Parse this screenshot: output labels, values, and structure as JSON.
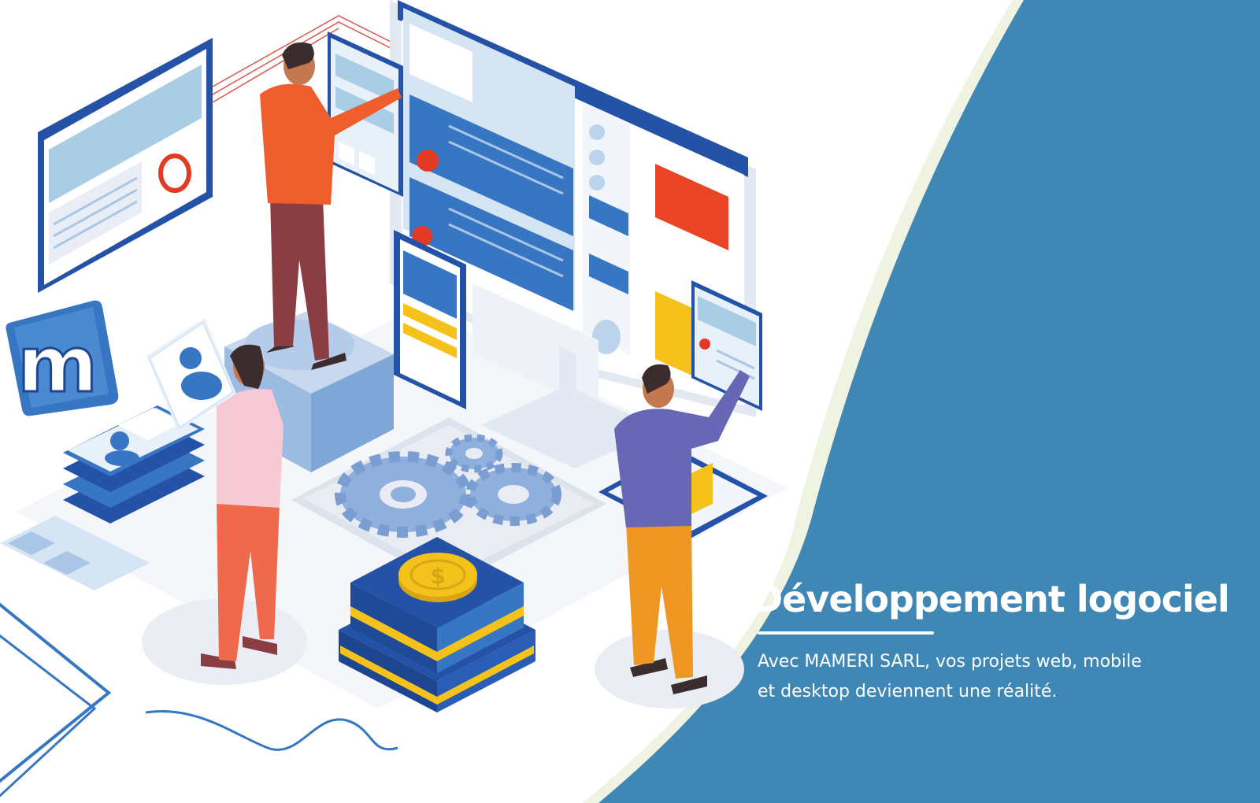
{
  "headline": {
    "title": "Développement logociel",
    "subtitle_line1": "Avec MAMERI SARL, vos projets web, mobile",
    "subtitle_line2": "et desktop deviennent une réalité."
  },
  "logo": {
    "letter": "m"
  },
  "colors": {
    "panel_blue": "#3f87b4",
    "accent_cream": "#eef3e2",
    "navy": "#2452a6",
    "mid_blue": "#3676c2",
    "light_blue": "#a9c6e6",
    "pale_blue": "#d6e5f4",
    "red": "#e23a23",
    "orange_shirt": "#ee5d2c",
    "maroon_pants": "#8a3e44",
    "pink_shirt": "#f7c9d4",
    "coral_pants": "#ef6a4c",
    "purple_shirt": "#6867b5",
    "mustard_pants": "#ee9722",
    "gold": "#f4c21a",
    "skin": "#c4784f",
    "hair": "#3b2d2d",
    "gear": "#8fb0dd"
  }
}
